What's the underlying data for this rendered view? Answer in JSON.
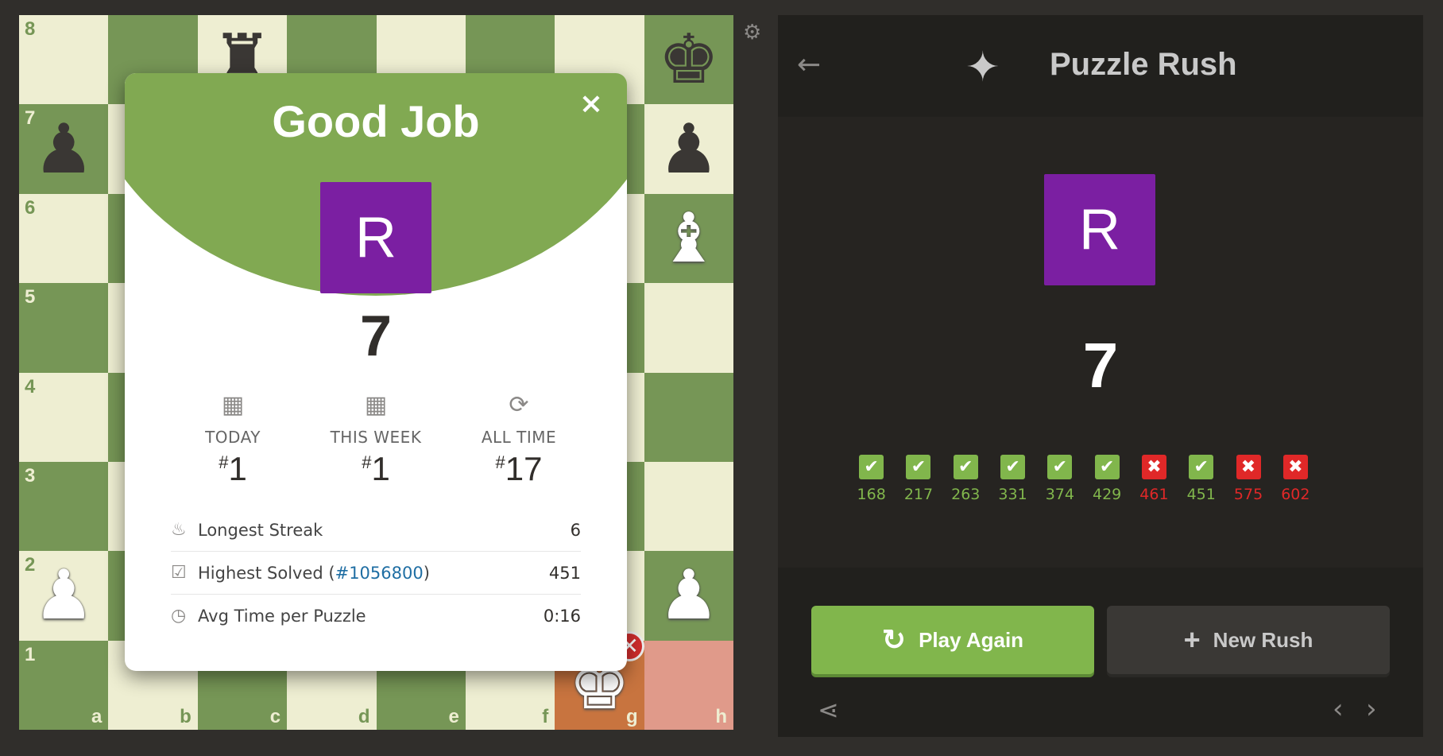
{
  "board": {
    "ranks": [
      "8",
      "7",
      "6",
      "5",
      "4",
      "3",
      "2",
      "1"
    ],
    "files": [
      "a",
      "b",
      "c",
      "d",
      "e",
      "f",
      "g",
      "h"
    ],
    "pieces": [
      {
        "square": "c8",
        "glyph": "♜",
        "color": "black"
      },
      {
        "square": "h8",
        "glyph": "♚",
        "color": "black"
      },
      {
        "square": "a7",
        "glyph": "♟",
        "color": "black"
      },
      {
        "square": "h7",
        "glyph": "♟",
        "color": "black"
      },
      {
        "square": "h6",
        "glyph": "♝",
        "color": "white"
      },
      {
        "square": "a2",
        "glyph": "♟",
        "color": "white"
      },
      {
        "square": "h2",
        "glyph": "♟",
        "color": "white"
      },
      {
        "square": "g1",
        "glyph": "♚",
        "color": "white"
      }
    ],
    "highlight_last": "g1",
    "highlight_red": "h1",
    "wrong_marker": "✕"
  },
  "modal": {
    "title": "Good Job",
    "close_label": "×",
    "avatar_letter": "R",
    "score": "7",
    "ranks": [
      {
        "label": "TODAY",
        "value": "1",
        "icon": "calendar-icon"
      },
      {
        "label": "THIS WEEK",
        "value": "1",
        "icon": "calendar-icon"
      },
      {
        "label": "ALL TIME",
        "value": "17",
        "icon": "refresh-icon"
      }
    ],
    "stats": {
      "streak_label": "Longest Streak",
      "streak_value": "6",
      "highest_label_prefix": "Highest Solved (",
      "highest_link": "#1056800",
      "highest_label_suffix": ")",
      "highest_value": "451",
      "avg_label": "Avg Time per Puzzle",
      "avg_value": "0:16"
    }
  },
  "panel": {
    "title": "Puzzle Rush",
    "avatar_letter": "R",
    "score": "7",
    "results": [
      {
        "value": "168",
        "correct": true
      },
      {
        "value": "217",
        "correct": true
      },
      {
        "value": "263",
        "correct": true
      },
      {
        "value": "331",
        "correct": true
      },
      {
        "value": "374",
        "correct": true
      },
      {
        "value": "429",
        "correct": true
      },
      {
        "value": "461",
        "correct": false
      },
      {
        "value": "451",
        "correct": true
      },
      {
        "value": "575",
        "correct": false
      },
      {
        "value": "602",
        "correct": false
      }
    ],
    "play_again_label": "Play Again",
    "new_rush_label": "New Rush"
  },
  "colors": {
    "light_square": "#eeeed2",
    "dark_square": "#769656",
    "accent_green": "#81b64c",
    "error_red": "#e02828",
    "avatar_purple": "#7b1fa2"
  }
}
